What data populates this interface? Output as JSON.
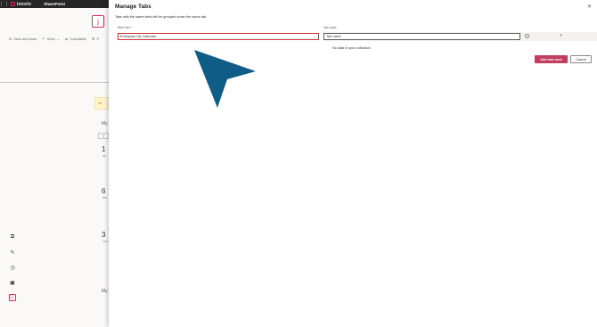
{
  "suite_bar": {
    "waffle_icon": "waffle-icon",
    "brand": "involv",
    "app": "SharePoint"
  },
  "background": {
    "logo_letter": "j",
    "commands": [
      {
        "icon": "save-close-icon",
        "label": "Save and close"
      },
      {
        "icon": "undo-icon",
        "label": "Undo"
      },
      {
        "icon": "translation-icon",
        "label": "Translation"
      },
      {
        "icon": "more-icon",
        "label": "P"
      }
    ],
    "warning_text": "Yo",
    "my_label_1": "My",
    "my_label_2": "My",
    "items": [
      {
        "num": "1",
        "sub": "Ap"
      },
      {
        "num": "6",
        "sub": "Ma"
      },
      {
        "num": "3",
        "sub": "Jun"
      }
    ],
    "rail_icons": [
      "layers-icon",
      "edit-icon",
      "clock-icon",
      "calendar-icon",
      "involv-j-icon"
    ]
  },
  "modal": {
    "title": "Manage Tabs",
    "description": "Tabs with the same label will be grouped under the same tab.",
    "web_part_label": "Web Part",
    "web_part_required": "*",
    "web_part_value": "Enterprise My Calendar",
    "tab_label_header": "Tab Label",
    "tab_label_value": "Tab Label",
    "no_data": "No data in your collection.",
    "primary_button": "Add and save",
    "secondary_button": "Cancel",
    "accent_color": "#c33d5f"
  }
}
